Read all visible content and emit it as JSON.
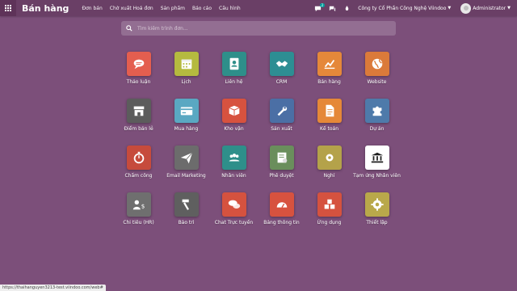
{
  "navbar": {
    "brand": "Bán hàng",
    "menu": [
      "Đơn bán",
      "Chờ xuất Hoá đơn",
      "Sản phẩm",
      "Báo cáo",
      "Cấu hình"
    ],
    "chat_badge": "2",
    "company": "Công ty Cổ Phần Công Nghệ Viindoo",
    "user": "Administrator"
  },
  "search": {
    "placeholder": "Tìm kiếm trình đơn..."
  },
  "apps": [
    {
      "label": "Thảo luận",
      "icon": "discuss-icon",
      "color": "#e45e4f"
    },
    {
      "label": "Lịch",
      "icon": "calendar-icon",
      "color": "#b5ba3f"
    },
    {
      "label": "Liên hệ",
      "icon": "contacts-icon",
      "color": "#2e8f8a"
    },
    {
      "label": "CRM",
      "icon": "handshake-icon",
      "color": "#2d8e93"
    },
    {
      "label": "Bán hàng",
      "icon": "sales-chart-icon",
      "color": "#e5883a"
    },
    {
      "label": "Website",
      "icon": "globe-icon",
      "color": "#db7a3a"
    },
    {
      "label": "Điểm bán lẻ",
      "icon": "shop-icon",
      "color": "#5c5c5c"
    },
    {
      "label": "Mua hàng",
      "icon": "credit-card-icon",
      "color": "#5aa8c2"
    },
    {
      "label": "Kho vận",
      "icon": "box-icon",
      "color": "#d7523f"
    },
    {
      "label": "Sản xuất",
      "icon": "wrench-icon",
      "color": "#4b6fa5"
    },
    {
      "label": "Kế toán",
      "icon": "invoice-icon",
      "color": "#e58838"
    },
    {
      "label": "Dự án",
      "icon": "puzzle-icon",
      "color": "#4e7aaa"
    },
    {
      "label": "Chấm công",
      "icon": "stopwatch-icon",
      "color": "#c64b3c"
    },
    {
      "label": "Email Marketing",
      "icon": "paper-plane-icon",
      "color": "#6c6c6c"
    },
    {
      "label": "Nhân viên",
      "icon": "employees-icon",
      "color": "#2e8f8a"
    },
    {
      "label": "Phê duyệt",
      "icon": "approval-icon",
      "color": "#6a8e5c"
    },
    {
      "label": "Nghỉ",
      "icon": "leave-icon",
      "color": "#b4a24a"
    },
    {
      "label": "Tạm ứng Nhân viên",
      "icon": "bank-icon",
      "color": "#ffffff"
    },
    {
      "label": "Chi tiêu (HR)",
      "icon": "expense-icon",
      "color": "#6f6f6f"
    },
    {
      "label": "Bảo trì",
      "icon": "hammer-icon",
      "color": "#5f5f5f"
    },
    {
      "label": "Chat Trực tuyến",
      "icon": "live-chat-icon",
      "color": "#d5523f"
    },
    {
      "label": "Bảng thông tin",
      "icon": "dashboard-icon",
      "color": "#d7523f"
    },
    {
      "label": "Ứng dụng",
      "icon": "cubes-icon",
      "color": "#d5523f"
    },
    {
      "label": "Thiết lập",
      "icon": "settings-icon",
      "color": "#b9a84a"
    }
  ],
  "status_bar": {
    "url": "https://thaihanguyen3213-test.viindoo.com/web#"
  }
}
